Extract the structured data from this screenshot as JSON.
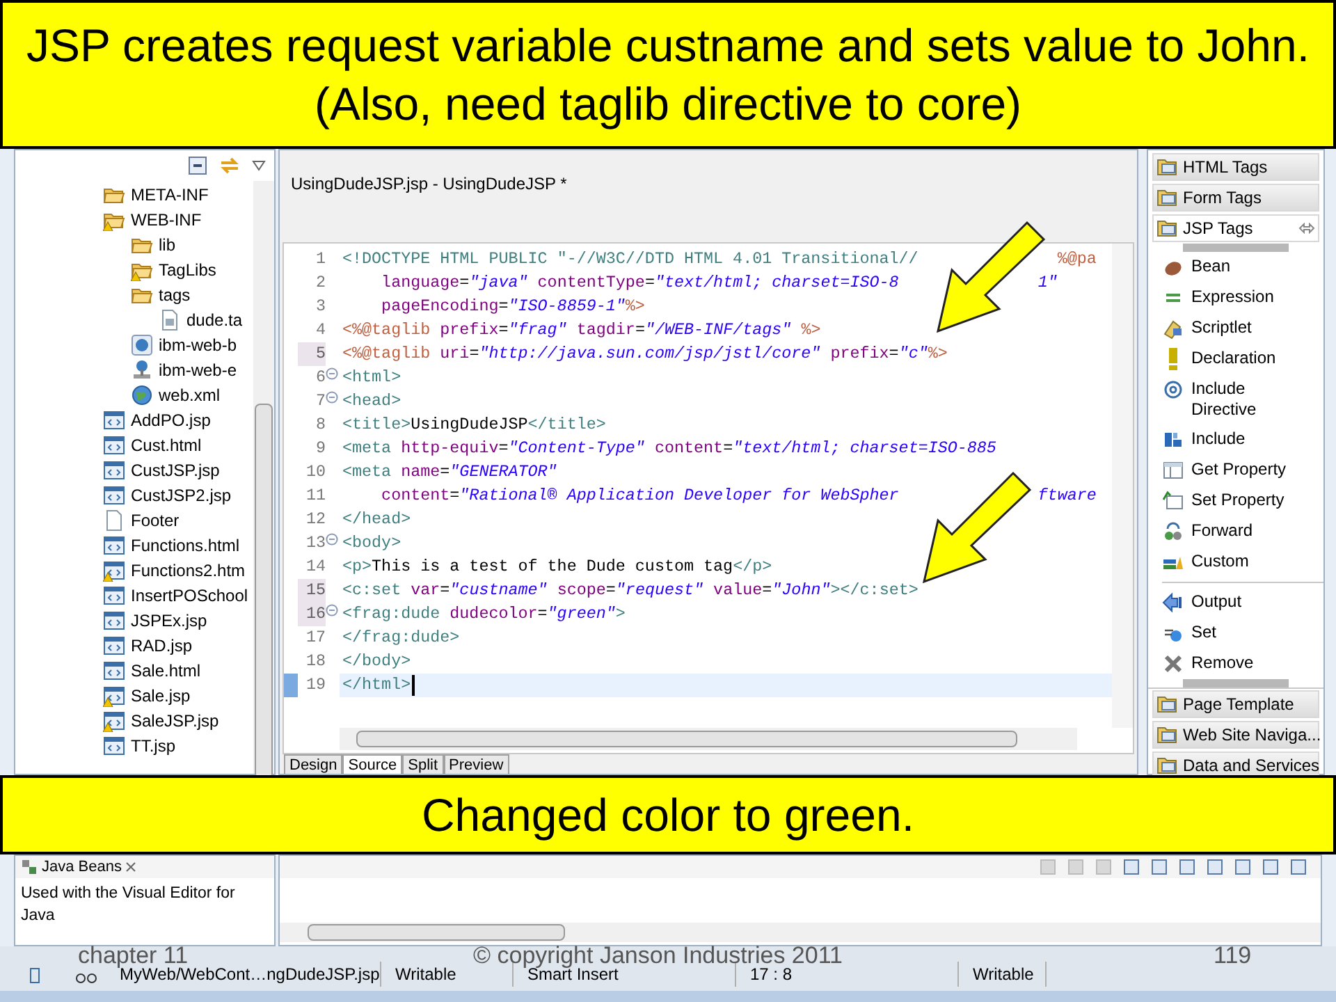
{
  "top_callout": {
    "text": "JSP creates request variable custname and sets value to John.  (Also, need taglib directive to core)"
  },
  "project_explorer": {
    "items": [
      {
        "label": "META-INF",
        "kind": "folder",
        "warning": false
      },
      {
        "label": "WEB-INF",
        "kind": "folder",
        "warning": true,
        "children": [
          {
            "label": "lib",
            "kind": "folder",
            "warning": false
          },
          {
            "label": "TagLibs",
            "kind": "folder",
            "warning": true
          },
          {
            "label": "tags",
            "kind": "folder",
            "warning": false,
            "children": [
              {
                "label": "dude.ta",
                "kind": "tagfile",
                "warning": false
              }
            ]
          },
          {
            "label": "ibm-web-b",
            "kind": "config",
            "warning": false
          },
          {
            "label": "ibm-web-e",
            "kind": "extension",
            "warning": false
          },
          {
            "label": "web.xml",
            "kind": "globe",
            "warning": false
          }
        ]
      },
      {
        "label": "AddPO.jsp",
        "kind": "web",
        "warning": false
      },
      {
        "label": "Cust.html",
        "kind": "web",
        "warning": false
      },
      {
        "label": "CustJSP.jsp",
        "kind": "web",
        "warning": false
      },
      {
        "label": "CustJSP2.jsp",
        "kind": "web",
        "warning": false
      },
      {
        "label": "Footer",
        "kind": "page",
        "warning": false
      },
      {
        "label": "Functions.html",
        "kind": "web",
        "warning": false
      },
      {
        "label": "Functions2.htm",
        "kind": "web",
        "warning": true
      },
      {
        "label": "InsertPOSchool",
        "kind": "web",
        "warning": false
      },
      {
        "label": "JSPEx.jsp",
        "kind": "web",
        "warning": false
      },
      {
        "label": "RAD.jsp",
        "kind": "web",
        "warning": false
      },
      {
        "label": "Sale.html",
        "kind": "web",
        "warning": false
      },
      {
        "label": "Sale.jsp",
        "kind": "web",
        "warning": true
      },
      {
        "label": "SaleJSP.jsp",
        "kind": "web",
        "warning": true
      },
      {
        "label": "TT.jsp",
        "kind": "web",
        "warning": false
      }
    ]
  },
  "editor": {
    "title": "UsingDudeJSP.jsp - UsingDudeJSP *",
    "lines": [
      {
        "number": "1",
        "fold": false,
        "changed": false,
        "current": false,
        "tokens": [
          {
            "t": "<!DOCTYPE HTML PUBLIC ",
            "kind": "tag"
          },
          {
            "t": "\"-//W3C//DTD HTML 4.01 Transitional//",
            "kind": "tag"
          }
        ],
        "tail": [
          {
            "t": "%@pa",
            "kind": "jsp"
          }
        ]
      },
      {
        "number": "2",
        "fold": false,
        "changed": false,
        "current": false,
        "tokens": [
          {
            "t": "    language",
            "kind": "attr"
          },
          {
            "t": "=",
            "kind": "plain"
          },
          {
            "t": "\"java\"",
            "kind": "value"
          },
          {
            "t": " contentType",
            "kind": "attr"
          },
          {
            "t": "=",
            "kind": "plain"
          },
          {
            "t": "\"text/html; charset=ISO-8",
            "kind": "value"
          }
        ],
        "tail": [
          {
            "t": "1\"",
            "kind": "value"
          }
        ]
      },
      {
        "number": "3",
        "fold": false,
        "changed": false,
        "current": false,
        "tokens": [
          {
            "t": "    pageEncoding",
            "kind": "attr"
          },
          {
            "t": "=",
            "kind": "plain"
          },
          {
            "t": "\"ISO-8859-1\"",
            "kind": "value"
          },
          {
            "t": "%>",
            "kind": "jsp"
          }
        ]
      },
      {
        "number": "4",
        "fold": false,
        "changed": false,
        "current": false,
        "tokens": [
          {
            "t": "<%@taglib",
            "kind": "jsp"
          },
          {
            "t": " prefix",
            "kind": "attr"
          },
          {
            "t": "=",
            "kind": "plain"
          },
          {
            "t": "\"frag\"",
            "kind": "value"
          },
          {
            "t": " tagdir",
            "kind": "attr"
          },
          {
            "t": "=",
            "kind": "plain"
          },
          {
            "t": "\"/WEB-INF/tags\"",
            "kind": "value"
          },
          {
            "t": " %>",
            "kind": "jsp"
          }
        ]
      },
      {
        "number": "5",
        "fold": false,
        "changed": true,
        "current": false,
        "tokens": [
          {
            "t": "<%@taglib",
            "kind": "jsp"
          },
          {
            "t": " uri",
            "kind": "attr"
          },
          {
            "t": "=",
            "kind": "plain"
          },
          {
            "t": "\"http://java.sun.com/jsp/jstl/core\"",
            "kind": "value"
          },
          {
            "t": " prefix",
            "kind": "attr"
          },
          {
            "t": "=",
            "kind": "plain"
          },
          {
            "t": "\"c\"",
            "kind": "value"
          },
          {
            "t": "%>",
            "kind": "jsp"
          }
        ]
      },
      {
        "number": "6",
        "fold": true,
        "changed": false,
        "current": false,
        "tokens": [
          {
            "t": "<html>",
            "kind": "tag"
          }
        ]
      },
      {
        "number": "7",
        "fold": true,
        "changed": false,
        "current": false,
        "tokens": [
          {
            "t": "<head>",
            "kind": "tag"
          }
        ]
      },
      {
        "number": "8",
        "fold": false,
        "changed": false,
        "current": false,
        "tokens": [
          {
            "t": "<title>",
            "kind": "tag"
          },
          {
            "t": "UsingDudeJSP",
            "kind": "text"
          },
          {
            "t": "</title>",
            "kind": "tag"
          }
        ]
      },
      {
        "number": "9",
        "fold": false,
        "changed": false,
        "current": false,
        "tokens": [
          {
            "t": "<meta",
            "kind": "tag"
          },
          {
            "t": " http-equiv",
            "kind": "attr"
          },
          {
            "t": "=",
            "kind": "plain"
          },
          {
            "t": "\"Content-Type\"",
            "kind": "value"
          },
          {
            "t": " content",
            "kind": "attr"
          },
          {
            "t": "=",
            "kind": "plain"
          },
          {
            "t": "\"text/html; charset=ISO-885",
            "kind": "value"
          }
        ]
      },
      {
        "number": "10",
        "fold": false,
        "changed": false,
        "current": false,
        "tokens": [
          {
            "t": "<meta",
            "kind": "tag"
          },
          {
            "t": " name",
            "kind": "attr"
          },
          {
            "t": "=",
            "kind": "plain"
          },
          {
            "t": "\"GENERATOR\"",
            "kind": "value"
          }
        ]
      },
      {
        "number": "11",
        "fold": false,
        "changed": false,
        "current": false,
        "tokens": [
          {
            "t": "    content",
            "kind": "attr"
          },
          {
            "t": "=",
            "kind": "plain"
          },
          {
            "t": "\"Rational® Application Developer for WebSpher",
            "kind": "value"
          }
        ],
        "tail": [
          {
            "t": "ftware",
            "kind": "value"
          }
        ]
      },
      {
        "number": "12",
        "fold": false,
        "changed": false,
        "current": false,
        "tokens": [
          {
            "t": "</head>",
            "kind": "tag"
          }
        ]
      },
      {
        "number": "13",
        "fold": true,
        "changed": false,
        "current": false,
        "tokens": [
          {
            "t": "<body>",
            "kind": "tag"
          }
        ]
      },
      {
        "number": "14",
        "fold": false,
        "changed": false,
        "current": false,
        "tokens": [
          {
            "t": "<p>",
            "kind": "tag"
          },
          {
            "t": "This is a test of the Dude custom tag",
            "kind": "text"
          },
          {
            "t": "</p>",
            "kind": "tag"
          }
        ]
      },
      {
        "number": "15",
        "fold": false,
        "changed": true,
        "current": false,
        "tokens": [
          {
            "t": "<c:set",
            "kind": "tag"
          },
          {
            "t": " var",
            "kind": "attr"
          },
          {
            "t": "=",
            "kind": "plain"
          },
          {
            "t": "\"custname\"",
            "kind": "value"
          },
          {
            "t": " scope",
            "kind": "attr"
          },
          {
            "t": "=",
            "kind": "plain"
          },
          {
            "t": "\"request\"",
            "kind": "value"
          },
          {
            "t": " value",
            "kind": "attr"
          },
          {
            "t": "=",
            "kind": "plain"
          },
          {
            "t": "\"John\"",
            "kind": "value"
          },
          {
            "t": "></c:set>",
            "kind": "tag"
          }
        ]
      },
      {
        "number": "16",
        "fold": true,
        "changed": true,
        "current": false,
        "tokens": [
          {
            "t": "<frag:dude",
            "kind": "tag"
          },
          {
            "t": " dudecolor",
            "kind": "attr"
          },
          {
            "t": "=",
            "kind": "plain"
          },
          {
            "t": "\"green\"",
            "kind": "value"
          },
          {
            "t": ">",
            "kind": "tag"
          }
        ]
      },
      {
        "number": "17",
        "fold": false,
        "changed": false,
        "current": false,
        "tokens": [
          {
            "t": "</frag:dude>",
            "kind": "tag"
          }
        ]
      },
      {
        "number": "18",
        "fold": false,
        "changed": false,
        "current": false,
        "tokens": [
          {
            "t": "</body>",
            "kind": "tag"
          }
        ]
      },
      {
        "number": "19",
        "fold": false,
        "changed": false,
        "current": true,
        "tokens": [
          {
            "t": "</html>",
            "kind": "tag"
          }
        ]
      }
    ],
    "tabs": [
      {
        "label": "Design",
        "selected": false
      },
      {
        "label": "Source",
        "selected": true
      },
      {
        "label": "Split",
        "selected": false
      },
      {
        "label": "Preview",
        "selected": false
      }
    ]
  },
  "palette": {
    "drawers_top": [
      {
        "label": "HTML Tags",
        "expanded": false
      },
      {
        "label": "Form Tags",
        "expanded": false
      },
      {
        "label": "JSP Tags",
        "expanded": true
      }
    ],
    "groups": [
      [
        {
          "label": "Bean",
          "kind": "bean"
        },
        {
          "label": "Expression",
          "kind": "expression"
        },
        {
          "label": "Scriptlet",
          "kind": "scriptlet"
        },
        {
          "label": "Declaration",
          "kind": "declaration"
        },
        {
          "label": "Include Directive",
          "kind": "directive"
        },
        {
          "label": "Include",
          "kind": "include"
        },
        {
          "label": "Get Property",
          "kind": "get"
        },
        {
          "label": "Set Property",
          "kind": "set-property"
        },
        {
          "label": "Forward",
          "kind": "forward"
        },
        {
          "label": "Custom",
          "kind": "custom"
        }
      ],
      [
        {
          "label": "Output",
          "kind": "output"
        },
        {
          "label": "Set",
          "kind": "set"
        },
        {
          "label": "Remove",
          "kind": "remove"
        }
      ]
    ],
    "drawers_bottom": [
      {
        "label": "Page Template",
        "expanded": false
      },
      {
        "label": "Web Site Naviga...",
        "expanded": false
      },
      {
        "label": "Data and Services",
        "expanded": false
      }
    ]
  },
  "bottom_callout": {
    "text": "Changed color to green."
  },
  "java_beans": {
    "tab": "Java Beans",
    "description": "Used with the Visual Editor for Java"
  },
  "status_bar": {
    "items": [
      "MyWeb/WebCont…ngDudeJSP.jsp",
      "Writable",
      "Smart Insert",
      "17 : 8",
      "Writable"
    ]
  },
  "slide_footer": {
    "chapter": "chapter 11",
    "copyright": "© copyright Janson Industries 2011",
    "page": "119"
  }
}
